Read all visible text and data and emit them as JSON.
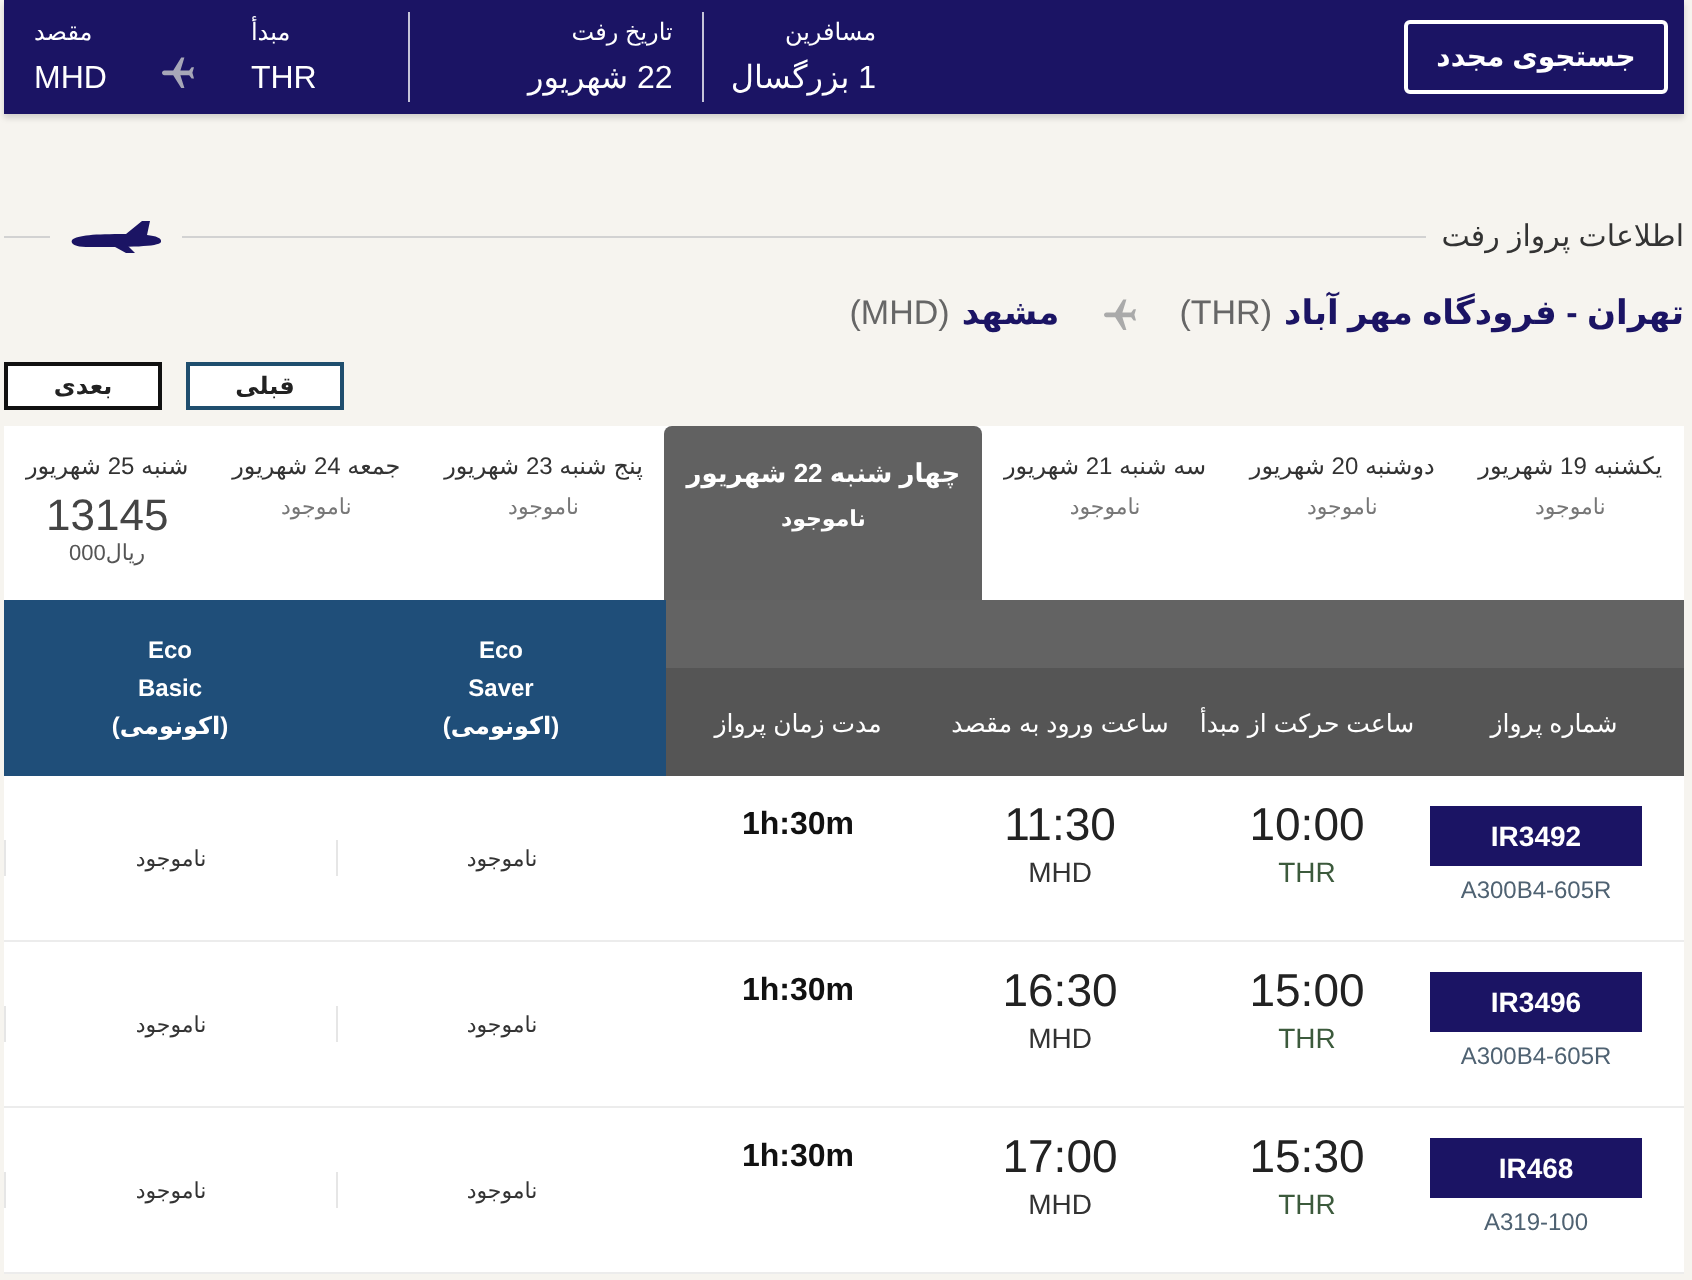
{
  "search_summary": {
    "search_again_button": "جستجوی مجدد",
    "passengers": {
      "label": "مسافرین",
      "value": "1 بزرگسال"
    },
    "departure_date": {
      "label": "تاریخ رفت",
      "value": "22 شهریور"
    },
    "origin": {
      "label": "مبدأ",
      "value": "THR"
    },
    "destination": {
      "label": "مقصد",
      "value": "MHD"
    }
  },
  "outbound": {
    "title": "اطلاعات پرواز رفت",
    "origin_name": "تهران - فرودگاه مهر آباد",
    "origin_code": "(THR)",
    "destination_name": "مشهد",
    "destination_code": "(MHD)"
  },
  "pager": {
    "previous": "قبلی",
    "next": "بعدی"
  },
  "date_tabs": [
    {
      "kind": "status",
      "date": "یکشنبه 19 شهریور",
      "status": "ناموجود",
      "selected": false
    },
    {
      "kind": "status",
      "date": "دوشنبه 20 شهریور",
      "status": "ناموجود",
      "selected": false
    },
    {
      "kind": "status",
      "date": "سه شنبه 21 شهریور",
      "status": "ناموجود",
      "selected": false
    },
    {
      "kind": "status",
      "date": "چهار شنبه 22 شهریور",
      "status": "ناموجود",
      "selected": true
    },
    {
      "kind": "status",
      "date": "پنج شنبه 23 شهریور",
      "status": "ناموجود",
      "selected": false
    },
    {
      "kind": "status",
      "date": "جمعه 24 شهریور",
      "status": "ناموجود",
      "selected": false
    },
    {
      "kind": "price",
      "date": "شنبه 25 شهریور",
      "price": "13145",
      "currency": "000ریال",
      "selected": false
    }
  ],
  "table": {
    "columns": [
      {
        "kind": "info",
        "label": "شماره پرواز"
      },
      {
        "kind": "info",
        "label": "ساعت حرکت از مبدأ"
      },
      {
        "kind": "info",
        "label": "ساعت ورود به مقصد"
      },
      {
        "kind": "info",
        "label": "مدت زمان پرواز"
      },
      {
        "kind": "fare",
        "label": "Eco\nSaver\n(اکونومی)"
      },
      {
        "kind": "fare",
        "label": "Eco\nBasic\n(اکونومی)"
      }
    ],
    "rows": [
      {
        "flight_number": "IR3492",
        "aircraft": "A300B4-605R",
        "departure_time": "10:00",
        "departure_airport": "THR",
        "arrival_time": "11:30",
        "arrival_airport": "MHD",
        "duration": "1h:30m",
        "fares": [
          "ناموجود",
          "ناموجود"
        ]
      },
      {
        "flight_number": "IR3496",
        "aircraft": "A300B4-605R",
        "departure_time": "15:00",
        "departure_airport": "THR",
        "arrival_time": "16:30",
        "arrival_airport": "MHD",
        "duration": "1h:30m",
        "fares": [
          "ناموجود",
          "ناموجود"
        ]
      },
      {
        "flight_number": "IR468",
        "aircraft": "A319-100",
        "departure_time": "15:30",
        "departure_airport": "THR",
        "arrival_time": "17:00",
        "arrival_airport": "MHD",
        "duration": "1h:30m",
        "fares": [
          "ناموجود",
          "ناموجود"
        ]
      }
    ]
  }
}
